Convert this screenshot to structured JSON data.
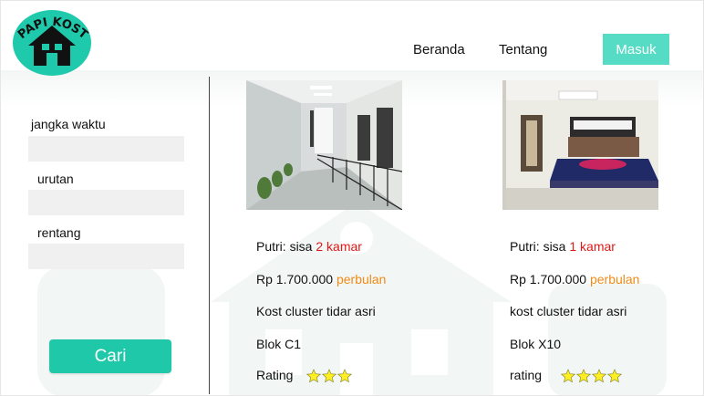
{
  "header": {
    "logo_text": "PAPI KOST",
    "nav": {
      "beranda": "Beranda",
      "tentang": "Tentang"
    },
    "login_button": "Masuk"
  },
  "sidebar": {
    "filters": [
      {
        "label": "jangka waktu",
        "value": ""
      },
      {
        "label": "urutan",
        "value": ""
      },
      {
        "label": "rentang",
        "value": ""
      }
    ],
    "search_button": "Cari"
  },
  "listings": [
    {
      "gender_label": "Putri: sisa ",
      "rooms_left": "2 kamar",
      "price": "Rp 1.700.000 ",
      "price_unit": "perbulan",
      "description": "Kost cluster tidar asri",
      "block": "Blok C1",
      "rating_label": "Rating",
      "rating_stars": 3
    },
    {
      "gender_label": "Putri: sisa ",
      "rooms_left": "1 kamar",
      "price": "Rp 1.700.000 ",
      "price_unit": "perbulan",
      "description": "kost cluster tidar asri",
      "block": "Blok X10",
      "rating_label": "rating",
      "rating_stars": 4
    }
  ],
  "colors": {
    "accent": "#56dcc4",
    "search_button": "#1ec8a8",
    "rooms_left": "#e01818",
    "price_unit": "#f08a16",
    "star": "#ffee22"
  }
}
